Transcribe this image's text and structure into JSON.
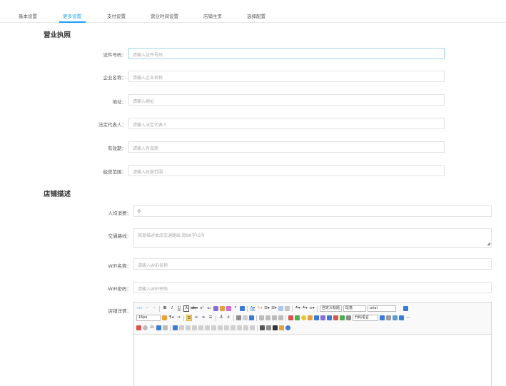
{
  "tabs": [
    {
      "label": "基本设置"
    },
    {
      "label": "更多设置",
      "active": true
    },
    {
      "label": "支付设置"
    },
    {
      "label": "营业时间设置"
    },
    {
      "label": "店铺主页"
    },
    {
      "label": "选择配置"
    }
  ],
  "license": {
    "title": "营业执照",
    "fields": [
      {
        "label": "证件号码：",
        "placeholder": "请输入证件号码"
      },
      {
        "label": "企业名称：",
        "placeholder": "请输入企业名称"
      },
      {
        "label": "地址：",
        "placeholder": "请输入地址"
      },
      {
        "label": "法定代表人：",
        "placeholder": "请输入法定代表人"
      },
      {
        "label": "有效期：",
        "placeholder": "请输入有效期"
      },
      {
        "label": "经营范围：",
        "placeholder": "请输入经营范围"
      }
    ]
  },
  "store": {
    "title": "店铺描述",
    "avg_spend": {
      "label": "人均消费：",
      "value": "0"
    },
    "route": {
      "label": "交通路线：",
      "placeholder": "简单描述本店交通路线,限80字以内"
    },
    "wifi_name": {
      "label": "WiFi名称：",
      "placeholder": "请输入WiFi名称"
    },
    "wifi_password": {
      "label": "WiFi密码：",
      "placeholder": "请输入WiFi密码"
    },
    "details": {
      "label": "店铺详情："
    }
  },
  "editor": {
    "paragraph_format": "自定义标题",
    "paragraph": "段落",
    "font_family": "arial",
    "font_size": "16px",
    "code_language": "代码语言",
    "toolbar_row1": [
      "B",
      "I",
      "U",
      "A"
    ],
    "quote_icon": "“",
    "colors": {
      "accent": "#1e9fff",
      "icon_blue": "#3a7bd5",
      "icon_orange": "#e8a23c",
      "icon_green": "#4caf50",
      "icon_red": "#d9534f"
    }
  }
}
